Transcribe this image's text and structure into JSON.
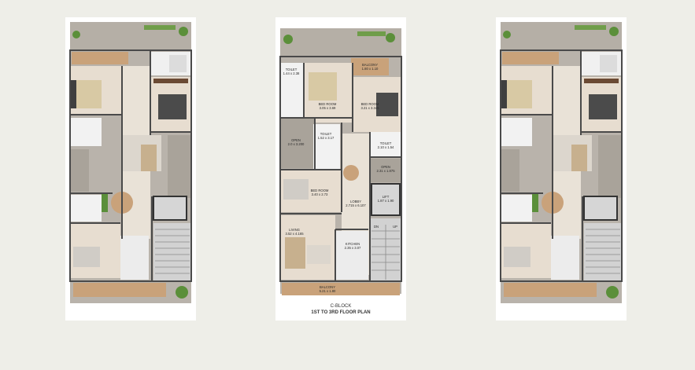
{
  "plans": {
    "middle": {
      "rooms": {
        "balcony_top": "BALCONY\n1.80 x 1.10",
        "toilet_1": "TOILET\n1.44 x 2.38",
        "bedroom_1": "BED ROOM\n3.05 x 3.69",
        "bedroom_2": "BED ROOM\n3.21 x 3.345",
        "toilet_2": "TOILET\n1.52 x 3.17",
        "open_1": "OPEN\n2.0 x 3.200",
        "toilet_3": "TOILET\n2.10 x 1.54",
        "open_2": "OPEN\n2.31 x 1.875",
        "bedroom_3": "BED ROOM\n3.40 x 2.73",
        "lobby": "LOBBY\n2.715 x 6.107",
        "lift": "LIFT\n1.87 x 1.90",
        "dn": "DN",
        "up": "UP",
        "living": "LIVING\n3.52 x 4.165",
        "kitchen": "KITCHEN\n2.35 x 3.07",
        "balcony_bottom": "BALCONY\n5.21 x 1.80"
      },
      "caption_block": "C-BLOCK",
      "caption_plan": "1ST TO 3RD FLOOR PLAN"
    }
  },
  "colors": {
    "background": "#eeeee8",
    "sheet": "#ffffff",
    "wall": "#4a4a4a",
    "floor_wood": "#e7ddd0",
    "terrace_tile": "#b9b3ab",
    "balcony_deck": "#c9a27a",
    "bed_linen": "#d8c9a4",
    "dark_bed": "#4b4b4b",
    "greenery": "#5b8f3a"
  }
}
